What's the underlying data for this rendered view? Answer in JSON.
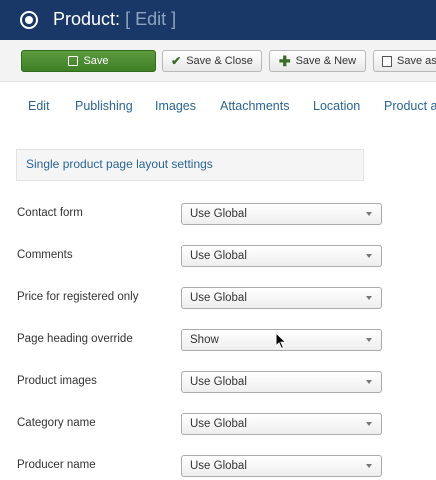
{
  "header": {
    "title": "Product:",
    "edit_tag": "[ Edit ]"
  },
  "toolbar": {
    "save_label": "Save",
    "save_close_label": "Save & Close",
    "save_new_label": "Save & New",
    "save_as_label": "Save as"
  },
  "tabs": [
    {
      "label": "Edit"
    },
    {
      "label": "Publishing"
    },
    {
      "label": "Images"
    },
    {
      "label": "Attachments"
    },
    {
      "label": "Location"
    },
    {
      "label": "Product a"
    }
  ],
  "section": {
    "title": "Single product page layout settings"
  },
  "fields": [
    {
      "label": "Contact form",
      "value": "Use Global"
    },
    {
      "label": "Comments",
      "value": "Use Global"
    },
    {
      "label": "Price for registered only",
      "value": "Use Global"
    },
    {
      "label": "Page heading override",
      "value": "Show"
    },
    {
      "label": "Product images",
      "value": "Use Global"
    },
    {
      "label": "Category name",
      "value": "Use Global"
    },
    {
      "label": "Producer name",
      "value": "Use Global"
    }
  ],
  "colors": {
    "header_bg": "#1a3867",
    "save_green": "#4a8a30",
    "link_blue": "#2a6496"
  }
}
